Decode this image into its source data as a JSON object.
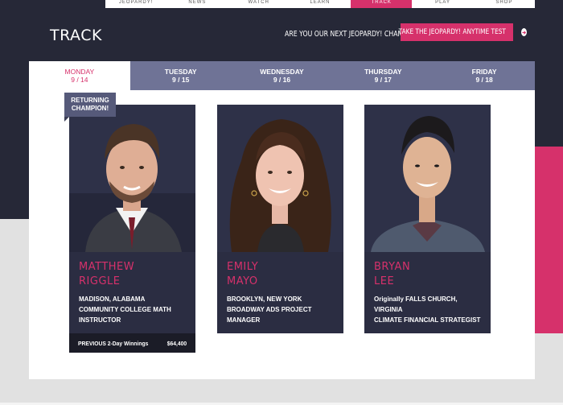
{
  "section_title": "TRACK",
  "cta": {
    "question": "ARE YOU OUR NEXT JEOPARDY! CHAMPION?",
    "button_label": "TAKE THE JEOPARDY! ANYTIME TEST"
  },
  "top_nav": [
    "JEOPARDY!",
    "NEWS",
    "WATCH",
    "LEARN",
    "TRACK",
    "PLAY",
    "SHOP"
  ],
  "days": [
    {
      "day": "MONDAY",
      "date": "9 / 14",
      "active": true
    },
    {
      "day": "TUESDAY",
      "date": "9 / 15",
      "active": false
    },
    {
      "day": "WEDNESDAY",
      "date": "9 / 16",
      "active": false
    },
    {
      "day": "THURSDAY",
      "date": "9 / 17",
      "active": false
    },
    {
      "day": "FRIDAY",
      "date": "9 / 18",
      "active": false
    }
  ],
  "badge": {
    "line1": "RETURNING",
    "line2": "CHAMPION!"
  },
  "contestants": [
    {
      "first": "MATTHEW",
      "last": "RIGGLE",
      "location": "MADISON, ALABAMA",
      "occupation_line1": "COMMUNITY COLLEGE MATH",
      "occupation_line2": "INSTRUCTOR",
      "winnings_label": "PREVIOUS 2-Day Winnings",
      "winnings_value": "$64,400"
    },
    {
      "first": "EMILY",
      "last": "MAYO",
      "location": "BROOKLYN, NEW YORK",
      "occupation_line1": "BROADWAY ADS PROJECT",
      "occupation_line2": "MANAGER"
    },
    {
      "first": "BRYAN",
      "last": "LEE",
      "location_line1": "Originally FALLS CHURCH,",
      "location_line2": "VIRGINIA",
      "occupation": "CLIMATE FINANCIAL STRATEGIST"
    }
  ],
  "colors": {
    "accent": "#d6316b",
    "dark": "#262837",
    "tab": "#6f7396",
    "card": "#2b2d42"
  }
}
